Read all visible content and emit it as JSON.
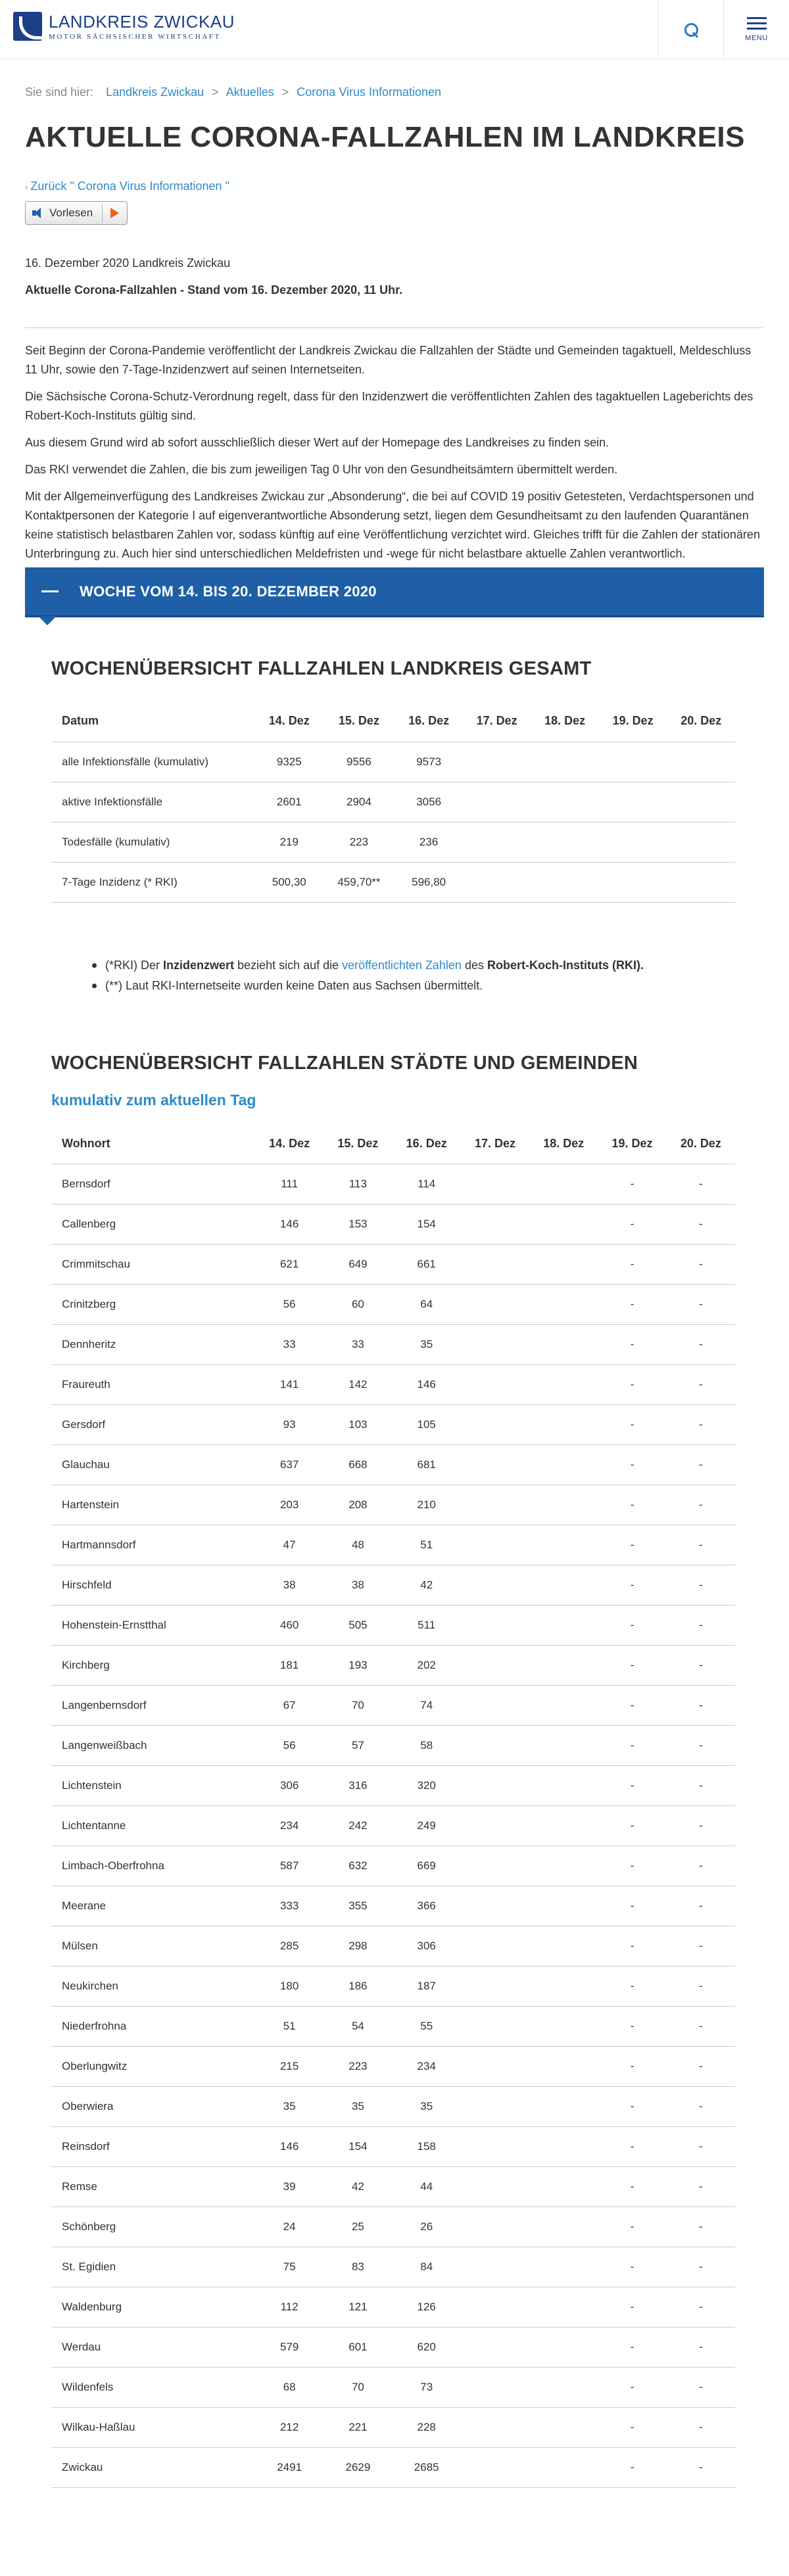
{
  "header": {
    "logo_name": "LANDKREIS ZWICKAU",
    "logo_sub": "MOTOR SÄCHSISCHER WIRTSCHAFT",
    "menu_label": "MENU"
  },
  "breadcrumb": {
    "prefix": "Sie sind hier:",
    "items": [
      "Landkreis Zwickau",
      "Aktuelles",
      "Corona Virus Informationen"
    ]
  },
  "page_title": "AKTUELLE CORONA-FALLZAHLEN IM LANDKREIS",
  "back_link": "Zurück \" Corona Virus Informationen \"",
  "vorlesen_label": "Vorlesen",
  "date_line": "16. Dezember 2020 Landkreis Zwickau",
  "subhead": "Aktuelle Corona-Fallzahlen - Stand vom 16. Dezember 2020, 11 Uhr.",
  "paragraphs": [
    "Seit Beginn der Corona-Pandemie veröffentlicht der Landkreis Zwickau die Fallzahlen der Städte und Gemeinden tagaktuell, Meldeschluss 11 Uhr, sowie den 7-Tage-Inzidenzwert auf seinen Internetseiten.",
    "Die Sächsische Corona-Schutz-Verordnung regelt, dass für den Inzidenzwert die veröffentlichten Zahlen des tagaktuellen Lageberichts des Robert-Koch-Instituts gültig sind.",
    "Aus diesem Grund wird ab sofort ausschließlich dieser Wert auf der Homepage des Landkreises zu finden sein.",
    "Das RKI verwendet die Zahlen, die bis zum jeweiligen Tag 0 Uhr von den Gesundheitsämtern übermittelt werden.",
    "Mit der Allgemeinverfügung des Landkreises Zwickau zur „Absonderung“, die bei auf COVID 19 positiv Getesteten, Verdachtspersonen und Kontaktpersonen der Kategorie I auf eigenverantwortliche Absonderung setzt, liegen dem Gesundheitsamt zu den laufenden Quarantänen keine statistisch belastbaren Zahlen vor, sodass künftig auf eine Veröffentlichung verzichtet wird. Gleiches trifft für die Zahlen der stationären Unterbringung zu. Auch hier sind unterschiedlichen Meldefristen und -wege für nicht belastbare aktuelle Zahlen verantwortlich."
  ],
  "accordion_label": "WOCHE VOM 14. BIS 20. DEZEMBER 2020",
  "table1": {
    "title": "WOCHENÜBERSICHT FALLZAHLEN LANDKREIS GESAMT",
    "headers": [
      "Datum",
      "14. Dez",
      "15. Dez",
      "16. Dez",
      "17. Dez",
      "18. Dez",
      "19. Dez",
      "20. Dez"
    ],
    "rows": [
      [
        "alle Infektionsfälle (kumulativ)",
        "9325",
        "9556",
        "9573",
        "",
        "",
        "",
        ""
      ],
      [
        "aktive Infektionsfälle",
        "2601",
        "2904",
        "3056",
        "",
        "",
        "",
        ""
      ],
      [
        "Todesfälle (kumulativ)",
        "219",
        "223",
        "236",
        "",
        "",
        "",
        ""
      ],
      [
        "7-Tage Inzidenz (* RKI)",
        "500,30",
        "459,70**",
        "596,80",
        "",
        "",
        "",
        ""
      ]
    ]
  },
  "notes": {
    "n1_a": "(*RKI) Der ",
    "n1_b": "Inzidenzwert",
    "n1_c": " bezieht sich auf die ",
    "n1_link": "veröffentlichten Zahlen",
    "n1_d": " des ",
    "n1_e": "Robert-Koch-Instituts (RKI).",
    "n2": "(**) Laut RKI-Internetseite wurden keine Daten aus Sachsen übermittelt."
  },
  "table2": {
    "title": "WOCHENÜBERSICHT FALLZAHLEN STÄDTE UND GEMEINDEN",
    "subtitle": "kumulativ zum aktuellen Tag",
    "headers": [
      "Wohnort",
      "14. Dez",
      "15. Dez",
      "16. Dez",
      "17. Dez",
      "18. Dez",
      "19. Dez",
      "20. Dez"
    ],
    "rows": [
      [
        "Bernsdorf",
        "111",
        "113",
        "114",
        "",
        "",
        "-",
        "-"
      ],
      [
        "Callenberg",
        "146",
        "153",
        "154",
        "",
        "",
        "-",
        "-"
      ],
      [
        "Crimmitschau",
        "621",
        "649",
        "661",
        "",
        "",
        "-",
        "-"
      ],
      [
        "Crinitzberg",
        "56",
        "60",
        "64",
        "",
        "",
        "-",
        "-"
      ],
      [
        "Dennheritz",
        "33",
        "33",
        "35",
        "",
        "",
        "-",
        "-"
      ],
      [
        "Fraureuth",
        "141",
        "142",
        "146",
        "",
        "",
        "-",
        "-"
      ],
      [
        "Gersdorf",
        "93",
        "103",
        "105",
        "",
        "",
        "-",
        "-"
      ],
      [
        "Glauchau",
        "637",
        "668",
        "681",
        "",
        "",
        "-",
        "-"
      ],
      [
        "Hartenstein",
        "203",
        "208",
        "210",
        "",
        "",
        "-",
        "-"
      ],
      [
        "Hartmannsdorf",
        "47",
        "48",
        "51",
        "",
        "",
        "-",
        "-"
      ],
      [
        "Hirschfeld",
        "38",
        "38",
        "42",
        "",
        "",
        "-",
        "-"
      ],
      [
        "Hohenstein-Ernstthal",
        "460",
        "505",
        "511",
        "",
        "",
        "-",
        "-"
      ],
      [
        "Kirchberg",
        "181",
        "193",
        "202",
        "",
        "",
        "-",
        "-"
      ],
      [
        "Langenbernsdorf",
        "67",
        "70",
        "74",
        "",
        "",
        "-",
        "-"
      ],
      [
        "Langenweißbach",
        "56",
        "57",
        "58",
        "",
        "",
        "-",
        "-"
      ],
      [
        "Lichtenstein",
        "306",
        "316",
        "320",
        "",
        "",
        "-",
        "-"
      ],
      [
        "Lichtentanne",
        "234",
        "242",
        "249",
        "",
        "",
        "-",
        "-"
      ],
      [
        "Limbach-Oberfrohna",
        "587",
        "632",
        "669",
        "",
        "",
        "-",
        "-"
      ],
      [
        "Meerane",
        "333",
        "355",
        "366",
        "",
        "",
        "-",
        "-"
      ],
      [
        "Mülsen",
        "285",
        "298",
        "306",
        "",
        "",
        "-",
        "-"
      ],
      [
        "Neukirchen",
        "180",
        "186",
        "187",
        "",
        "",
        "-",
        "-"
      ],
      [
        "Niederfrohna",
        "51",
        "54",
        "55",
        "",
        "",
        "-",
        "-"
      ],
      [
        "Oberlungwitz",
        "215",
        "223",
        "234",
        "",
        "",
        "-",
        "-"
      ],
      [
        "Oberwiera",
        "35",
        "35",
        "35",
        "",
        "",
        "-",
        "-"
      ],
      [
        "Reinsdorf",
        "146",
        "154",
        "158",
        "",
        "",
        "-",
        "-"
      ],
      [
        "Remse",
        "39",
        "42",
        "44",
        "",
        "",
        "-",
        "-"
      ],
      [
        "Schönberg",
        "24",
        "25",
        "26",
        "",
        "",
        "-",
        "-"
      ],
      [
        "St. Egidien",
        "75",
        "83",
        "84",
        "",
        "",
        "-",
        "-"
      ],
      [
        "Waldenburg",
        "112",
        "121",
        "126",
        "",
        "",
        "-",
        "-"
      ],
      [
        "Werdau",
        "579",
        "601",
        "620",
        "",
        "",
        "-",
        "-"
      ],
      [
        "Wildenfels",
        "68",
        "70",
        "73",
        "",
        "",
        "-",
        "-"
      ],
      [
        "Wilkau-Haßlau",
        "212",
        "221",
        "228",
        "",
        "",
        "-",
        "-"
      ],
      [
        "Zwickau",
        "2491",
        "2629",
        "2685",
        "",
        "",
        "-",
        "-"
      ]
    ]
  }
}
